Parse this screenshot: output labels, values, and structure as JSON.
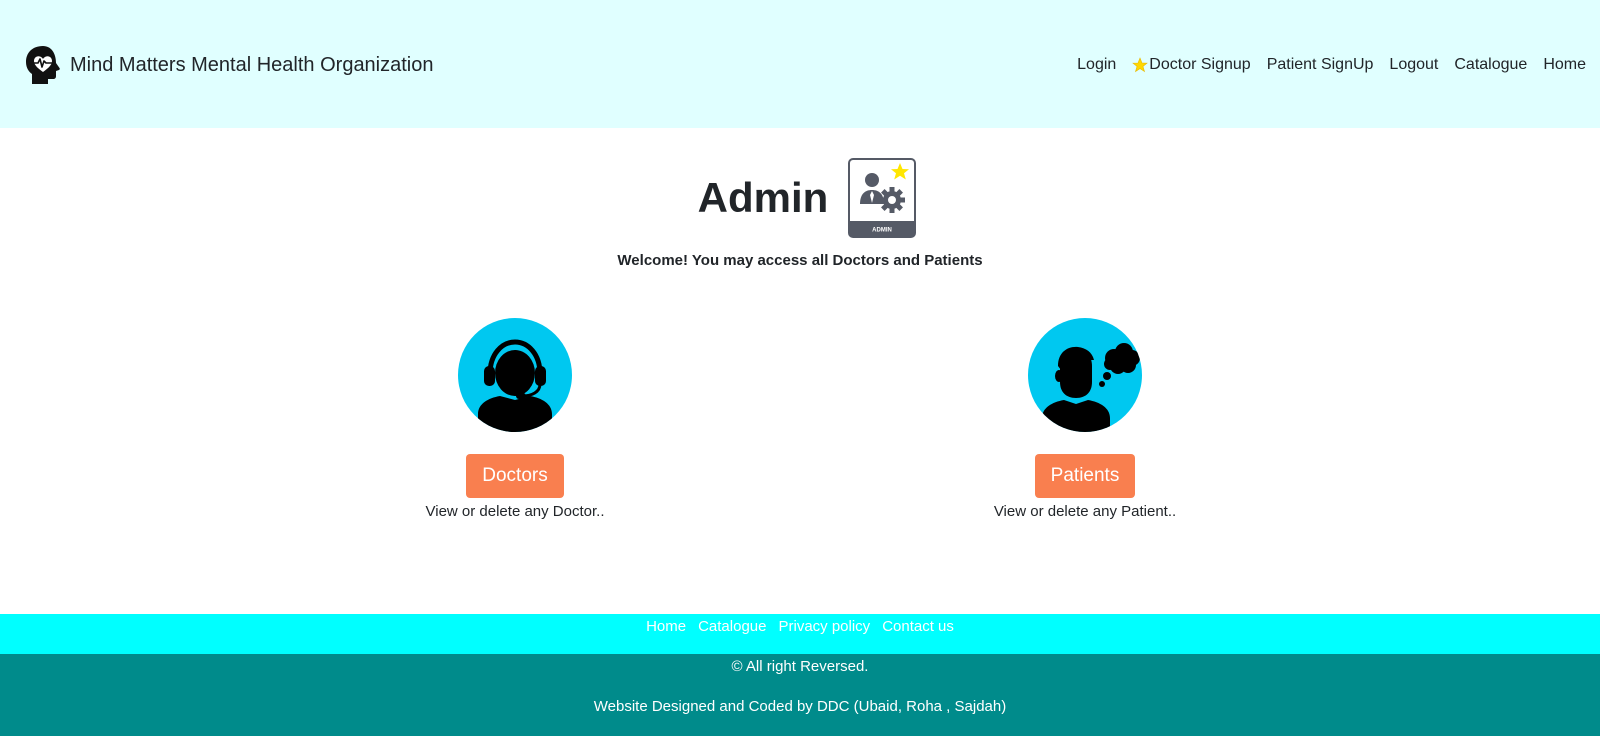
{
  "brand": {
    "name": "Mind Matters Mental Health Organization",
    "logo_icon": "head-heartbeat-icon"
  },
  "nav": {
    "items": [
      {
        "label": "Login"
      },
      {
        "label": "Doctor Signup",
        "icon": "star-icon"
      },
      {
        "label": "Patient SignUp"
      },
      {
        "label": "Logout"
      },
      {
        "label": "Catalogue"
      },
      {
        "label": "Home"
      }
    ]
  },
  "main": {
    "title": "Admin",
    "badge_icon": "admin-badge-icon",
    "badge_text": "ADMIN",
    "welcome": "Welcome! You may access all Doctors and Patients",
    "cards": [
      {
        "icon": "doctor-headset-icon",
        "button": "Doctors",
        "description": "View or delete any Doctor.."
      },
      {
        "icon": "patient-thinking-icon",
        "button": "Patients",
        "description": "View or delete any Patient.."
      }
    ]
  },
  "footer": {
    "links": [
      "Home",
      "Catalogue",
      "Privacy policy",
      "Contact us"
    ],
    "copyright": "© All right Reversed.",
    "credits": "Website Designed and Coded by DDC (Ubaid, Roha , Sajdah)"
  },
  "colors": {
    "navbar_bg": "#e0ffff",
    "accent_circle": "#00c8f0",
    "button_bg": "#f97f4f",
    "footer_links_bg": "#00ffff",
    "footer_bottom_bg": "#008b8b",
    "star": "#ffd700"
  }
}
